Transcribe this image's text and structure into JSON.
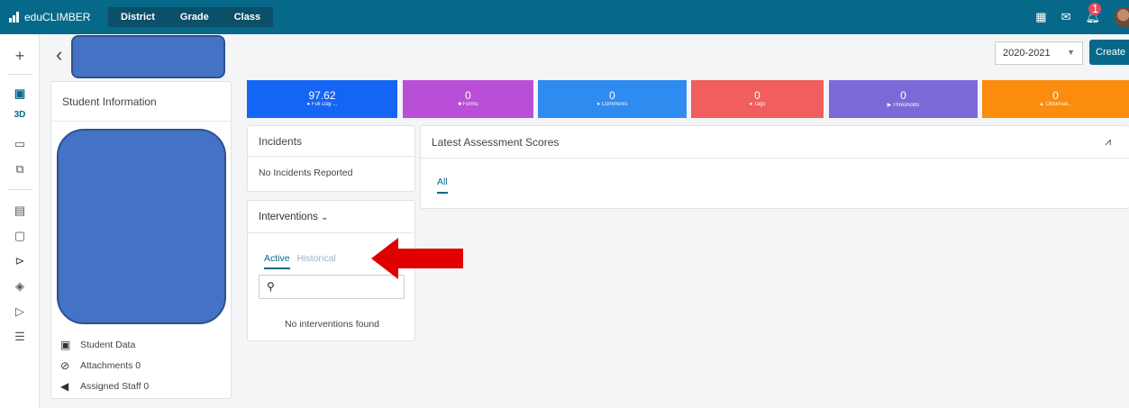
{
  "topbar": {
    "app_name": "eduCLIMBER",
    "nav": [
      "District",
      "Grade",
      "Class"
    ],
    "notification_count": "1"
  },
  "header": {
    "school_year": "2020-2021",
    "create_label": "Create"
  },
  "stats": [
    {
      "value": "97.62",
      "label": "Full Day ...",
      "color": "#1565f5"
    },
    {
      "value": "0",
      "label": "Forms",
      "color": "#b84fd6"
    },
    {
      "value": "0",
      "label": "Comments",
      "color": "#2e8bf0"
    },
    {
      "value": "0",
      "label": "Tags",
      "color": "#f05e5e"
    },
    {
      "value": "0",
      "label": "Thresholds",
      "color": "#7a6ad8"
    },
    {
      "value": "0",
      "label": "Observat...",
      "color": "#fb8c0d"
    }
  ],
  "student_info": {
    "title": "Student Information",
    "links": [
      "Student Data",
      "Attachments 0",
      "Assigned Staff 0"
    ]
  },
  "incidents": {
    "title": "Incidents",
    "empty_text": "No Incidents Reported"
  },
  "interventions": {
    "title": "Interventions",
    "tab_active": "Active",
    "tab_historical": "Historical",
    "empty_text": "No interventions found"
  },
  "assessment": {
    "title": "Latest Assessment Scores",
    "tab_all": "All"
  },
  "rail": {
    "item_3d": "3D"
  },
  "colors": {
    "primary": "#06698a",
    "annotation_arrow": "#e00000"
  }
}
